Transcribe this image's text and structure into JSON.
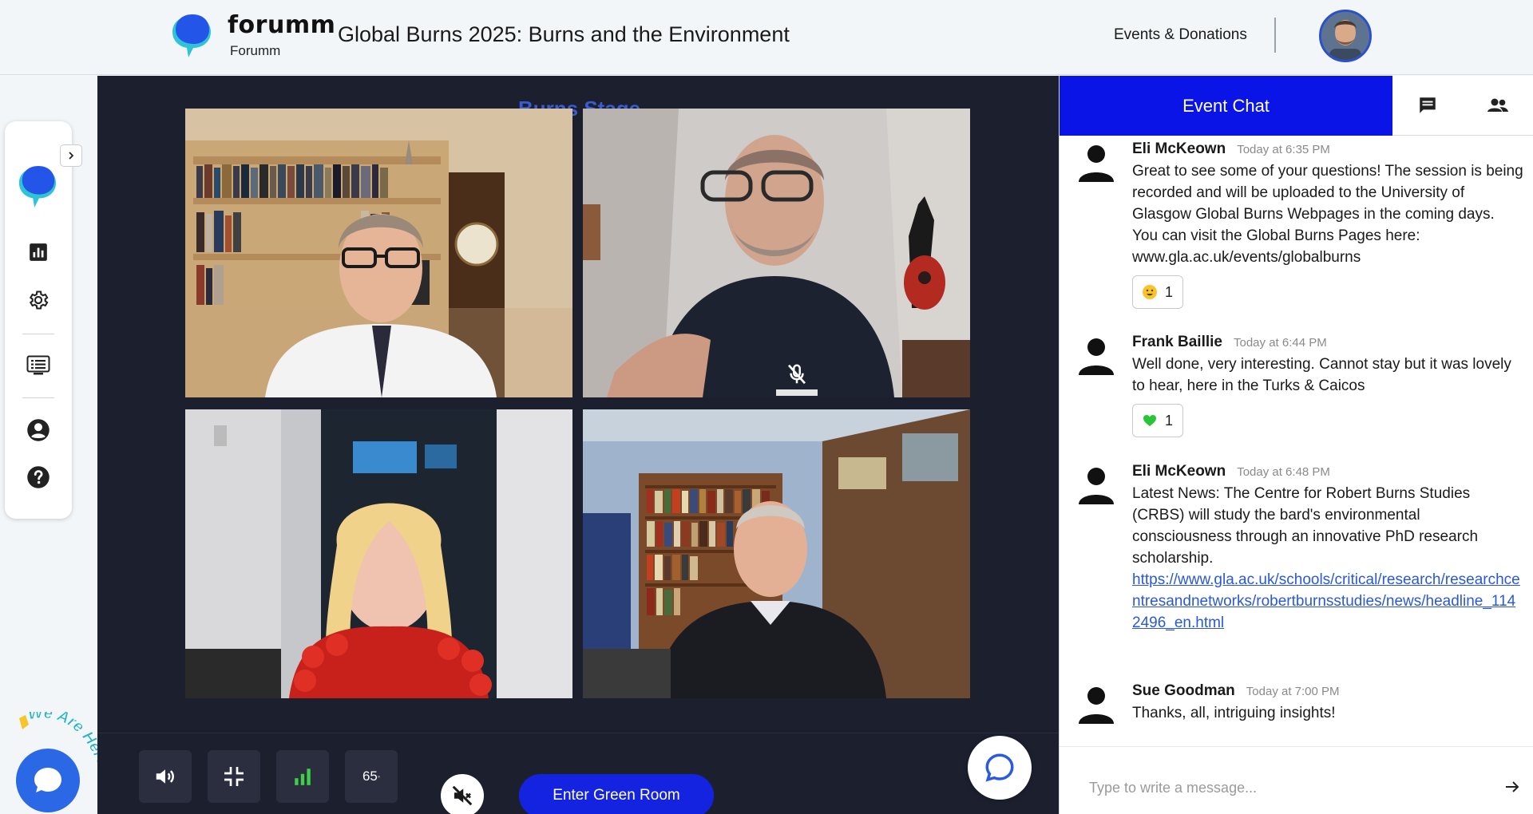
{
  "header": {
    "brand_name": "forumm",
    "brand_sub": "Forumm",
    "event_title": "Global Burns 2025: Burns and the Environment",
    "events_link": "Events & Donations"
  },
  "stage": {
    "title": "Burns Stage",
    "volume_level": "65"
  },
  "controls": {
    "enter_green_room": "Enter Green Room"
  },
  "chat": {
    "tab_label": "Event Chat",
    "input_placeholder": "Type to write a message...",
    "messages": [
      {
        "author": "Eli McKeown",
        "time": "Today at 6:35 PM",
        "text": "Great to see some of your questions! The session is being recorded and will be uploaded to the University of Glasgow Global Burns Webpages in the coming days. You can visit the Global Burns Pages here:",
        "text2": " www.gla.ac.uk/events/globalburns",
        "reaction_count": "1"
      },
      {
        "author": "Frank Baillie",
        "time": "Today at 6:44 PM",
        "text": "Well done, very interesting. Cannot stay but it was lovely to hear, here in the Turks & Caicos",
        "reaction_count": "1"
      },
      {
        "author": "Eli McKeown",
        "time": "Today at 6:48 PM",
        "text": "Latest News: The Centre for Robert Burns Studies (CRBS) will study the bard's environmental consciousness through an innovative PhD research scholarship.",
        "link": "https://www.gla.ac.uk/schools/critical/research/researchcentresandnetworks/robertburnsstudies/news/headline_1142496_en.html"
      },
      {
        "author": "Sue Goodman",
        "time": "Today at 7:00 PM",
        "text": "Thanks, all, intriguing insights!"
      }
    ]
  },
  "widget": {
    "label": "We Are Here!"
  },
  "colors": {
    "accent_blue": "#0a14e6",
    "stage_bg": "#1c1f2e",
    "link": "#2b58d8"
  }
}
